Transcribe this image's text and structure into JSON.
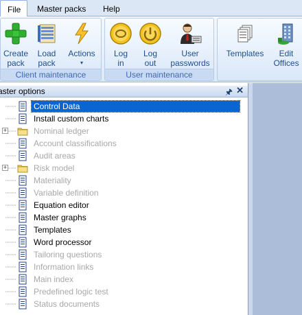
{
  "menu": {
    "tabs": [
      "File",
      "Master packs",
      "Help"
    ],
    "active": "File"
  },
  "ribbon": {
    "client_group": {
      "label": "Client maintenance",
      "buttons": [
        {
          "label": "Create\npack",
          "icon": "green-plus-icon"
        },
        {
          "label": "Load\npack",
          "icon": "pack-folder-icon"
        },
        {
          "label": "Actions",
          "icon": "lightning-icon",
          "dropdown": "▾"
        }
      ]
    },
    "user_group": {
      "label": "User maintenance",
      "buttons": [
        {
          "label": "Log\nin",
          "icon": "login-power-icon"
        },
        {
          "label": "Log\nout",
          "icon": "logout-power-icon"
        },
        {
          "label": "User\npasswords",
          "icon": "user-keyboard-icon"
        }
      ]
    },
    "third_group": {
      "buttons": [
        {
          "label": "Templates",
          "icon": "templates-icon"
        },
        {
          "label": "Edit\nOffices",
          "icon": "edit-offices-icon"
        }
      ]
    }
  },
  "panel": {
    "title": "aster options",
    "pin_icon": "pin-icon",
    "close_icon": "close-icon",
    "items": [
      {
        "label": "Control Data",
        "type": "doc",
        "state": "selected"
      },
      {
        "label": "Install custom charts",
        "type": "doc",
        "state": "normal"
      },
      {
        "label": "Nominal ledger",
        "type": "folder",
        "state": "disabled",
        "expandable": true
      },
      {
        "label": "Account classifications",
        "type": "doc",
        "state": "disabled"
      },
      {
        "label": "Audit areas",
        "type": "doc",
        "state": "disabled"
      },
      {
        "label": "Risk model",
        "type": "folder",
        "state": "disabled",
        "expandable": true
      },
      {
        "label": "Materiality",
        "type": "doc",
        "state": "disabled"
      },
      {
        "label": "Variable definition",
        "type": "doc",
        "state": "disabled"
      },
      {
        "label": "Equation editor",
        "type": "doc",
        "state": "normal"
      },
      {
        "label": "Master graphs",
        "type": "doc",
        "state": "normal"
      },
      {
        "label": "Templates",
        "type": "doc",
        "state": "normal"
      },
      {
        "label": "Word processor",
        "type": "doc",
        "state": "normal"
      },
      {
        "label": "Tailoring questions",
        "type": "doc",
        "state": "disabled"
      },
      {
        "label": "Information links",
        "type": "doc",
        "state": "disabled"
      },
      {
        "label": "Main index",
        "type": "doc",
        "state": "disabled"
      },
      {
        "label": "Predefined logic test",
        "type": "doc",
        "state": "disabled"
      },
      {
        "label": "Status documents",
        "type": "doc",
        "state": "disabled"
      }
    ]
  },
  "colors": {
    "selection": "#0a64d2",
    "ribbon_text": "#1e4e8c",
    "disabled_text": "#a8a8a8",
    "workspace": "#abbdd8"
  }
}
